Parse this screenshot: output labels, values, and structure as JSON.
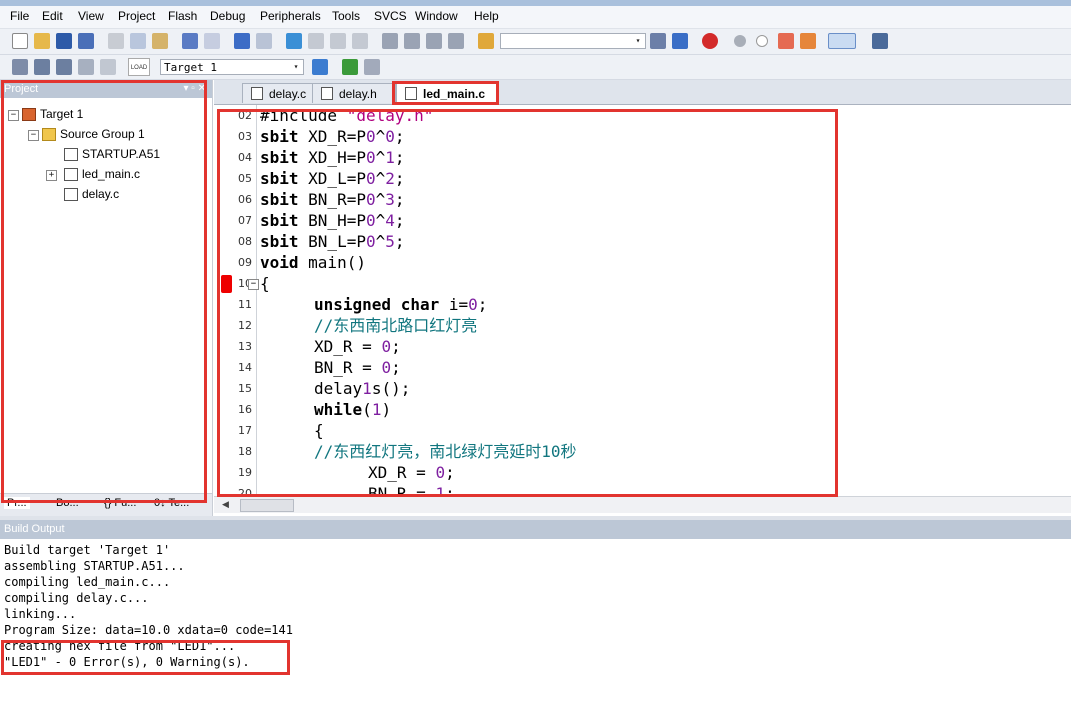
{
  "menu": [
    "File",
    "Edit",
    "View",
    "Project",
    "Flash",
    "Debug",
    "Peripherals",
    "Tools",
    "SVCS",
    "Window",
    "Help"
  ],
  "toolbar": {
    "target_combo": "Target 1",
    "target_combo_arrow": "▾",
    "search_combo_arrow": "▾",
    "load_label": "LOAD"
  },
  "project": {
    "title": "Project",
    "title_buttons": "▾ ▫ ✕",
    "tree": [
      {
        "label": "Target 1"
      },
      {
        "label": "Source Group 1"
      },
      {
        "label": "STARTUP.A51"
      },
      {
        "label": "led_main.c"
      },
      {
        "label": "delay.c"
      }
    ],
    "tabs": [
      "Pr...",
      "Bo...",
      "{} Fu...",
      "0↓ Te..."
    ]
  },
  "editor_tabs": [
    {
      "label": "delay.c"
    },
    {
      "label": "delay.h"
    },
    {
      "label": "led_main.c"
    }
  ],
  "code_lines": [
    {
      "no": "02",
      "text": "#include \"delay.h\""
    },
    {
      "no": "03",
      "kw": "sbit",
      "rest": " XD_R=P0^0;"
    },
    {
      "no": "04",
      "kw": "sbit",
      "rest": " XD_H=P0^1;"
    },
    {
      "no": "05",
      "kw": "sbit",
      "rest": " XD_L=P0^2;"
    },
    {
      "no": "06",
      "kw": "sbit",
      "rest": " BN_R=P0^3;"
    },
    {
      "no": "07",
      "kw": "sbit",
      "rest": " BN_H=P0^4;"
    },
    {
      "no": "08",
      "kw": "sbit",
      "rest": " BN_L=P0^5;"
    },
    {
      "no": "09",
      "kw": "void",
      "rest": " main()"
    },
    {
      "no": "10",
      "text": "{"
    },
    {
      "no": "11",
      "kw": "unsigned char",
      "rest": " i=0;"
    },
    {
      "no": "12",
      "text": "//东西南北路口红灯亮"
    },
    {
      "no": "13",
      "text": "XD_R = 0;"
    },
    {
      "no": "14",
      "text": "BN_R = 0;"
    },
    {
      "no": "15",
      "text": "delay1s();"
    },
    {
      "no": "16",
      "kw": "while",
      "rest": "(1)"
    },
    {
      "no": "17",
      "text": "{"
    },
    {
      "no": "18",
      "text": "//东西红灯亮，南北绿灯亮延时10秒"
    },
    {
      "no": "19",
      "text": "XD_R = 0;"
    },
    {
      "no": "20",
      "text": "BN_R = 1;"
    }
  ],
  "build_output": {
    "title": "Build Output",
    "lines": [
      "Build target 'Target 1'",
      "assembling STARTUP.A51...",
      "compiling led_main.c...",
      "compiling delay.c...",
      "linking...",
      "Program Size: data=10.0 xdata=0 code=141",
      "creating hex file from \"LED1\"...",
      "\"LED1\" - 0 Error(s), 0 Warning(s)."
    ]
  },
  "colors": {
    "highlight_box": "#e2342f",
    "keyword": "#000000",
    "comment": "#11767f",
    "number": "#7e1fa0",
    "string": "#b0007f"
  }
}
